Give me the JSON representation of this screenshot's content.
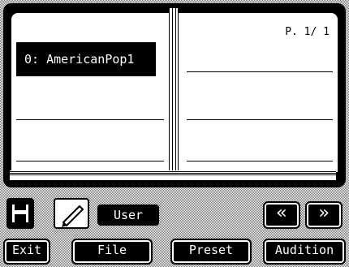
{
  "list": {
    "selected_item": "0: AmericanPop1",
    "page_indicator": "P. 1/ 1"
  },
  "controls": {
    "bank_label": "User",
    "prev_label": "«",
    "next_label": "»",
    "save_icon": "floppy-disk-icon",
    "edit_icon": "pencil-icon"
  },
  "buttons": {
    "exit": "Exit",
    "file": "File",
    "preset": "Preset",
    "audition": "Audition"
  }
}
